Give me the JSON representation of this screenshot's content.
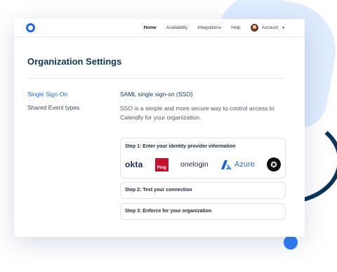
{
  "nav": {
    "links": [
      "Home",
      "Availability",
      "Integrations",
      "Help"
    ],
    "account_label": "Account"
  },
  "page": {
    "title": "Organization Settings"
  },
  "sidebar": {
    "items": [
      {
        "label": "Single Sign-On",
        "active": true
      },
      {
        "label": "Shared Event types",
        "active": false
      }
    ]
  },
  "main": {
    "heading": "SAML single sign-on (SSO)",
    "description": "SSO is a simple and more secure way to control access to Calendly for your organization.",
    "steps": [
      {
        "label": "Step 1: Enter your identity provider information"
      },
      {
        "label": "Step 2: Test your connection"
      },
      {
        "label": "Step 3: Enforce for your organization"
      }
    ],
    "providers": {
      "okta": "okta",
      "ping": "Ping",
      "onelogin": "onelogin",
      "azure": "Azure"
    }
  },
  "colors": {
    "accent": "#1a66e6",
    "title": "#0b3558",
    "ping_red": "#c8102e"
  }
}
